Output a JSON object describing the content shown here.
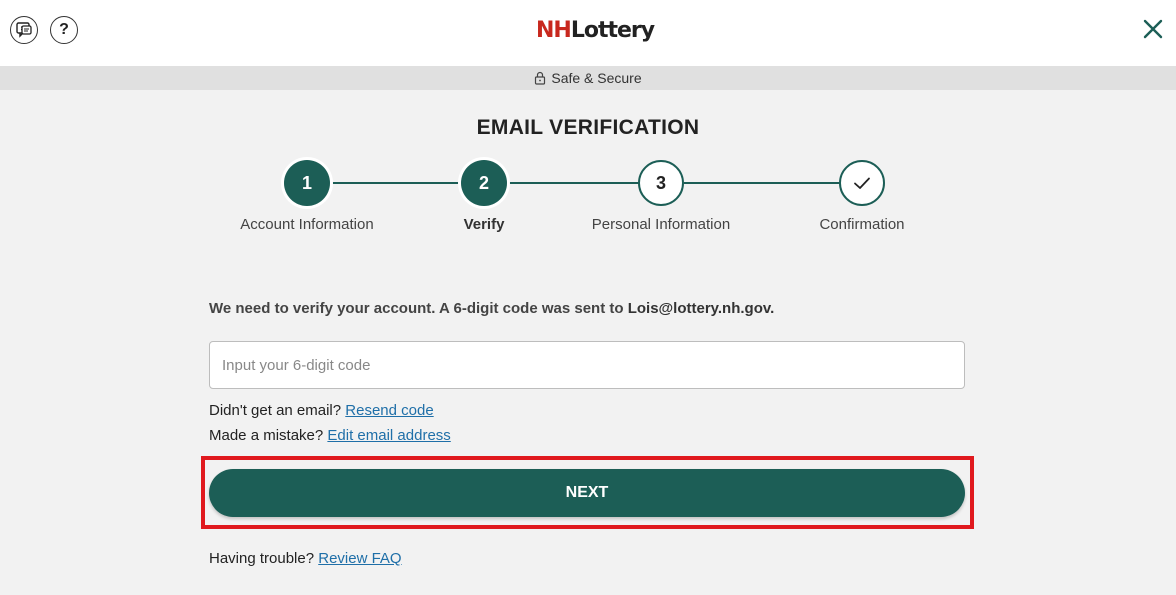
{
  "header": {
    "logo_nh": "NH",
    "logo_lottery": "Lottery",
    "secure_text": "Safe & Secure"
  },
  "page": {
    "title": "EMAIL VERIFICATION"
  },
  "steps": [
    {
      "number": "1",
      "label": "Account Information",
      "state": "complete"
    },
    {
      "number": "2",
      "label": "Verify",
      "state": "current"
    },
    {
      "number": "3",
      "label": "Personal Information",
      "state": "upcoming"
    },
    {
      "number": "",
      "label": "Confirmation",
      "state": "upcoming",
      "icon": "check-icon"
    }
  ],
  "verify": {
    "message": "We need to verify your account. A 6-digit code was sent to ",
    "email": "Lois@lottery.nh.gov.",
    "code_placeholder": "Input your 6-digit code",
    "code_value": "",
    "resend_prompt": "Didn't get an email? ",
    "resend_link": "Resend code",
    "edit_prompt": "Made a mistake? ",
    "edit_link": "Edit email address",
    "next_label": "NEXT",
    "trouble_prompt": "Having trouble? ",
    "faq_link": "Review FAQ"
  },
  "colors": {
    "primary": "#1c5e56",
    "link": "#1f6fa8",
    "highlight": "#e0191e",
    "logo_red": "#c8281e"
  }
}
